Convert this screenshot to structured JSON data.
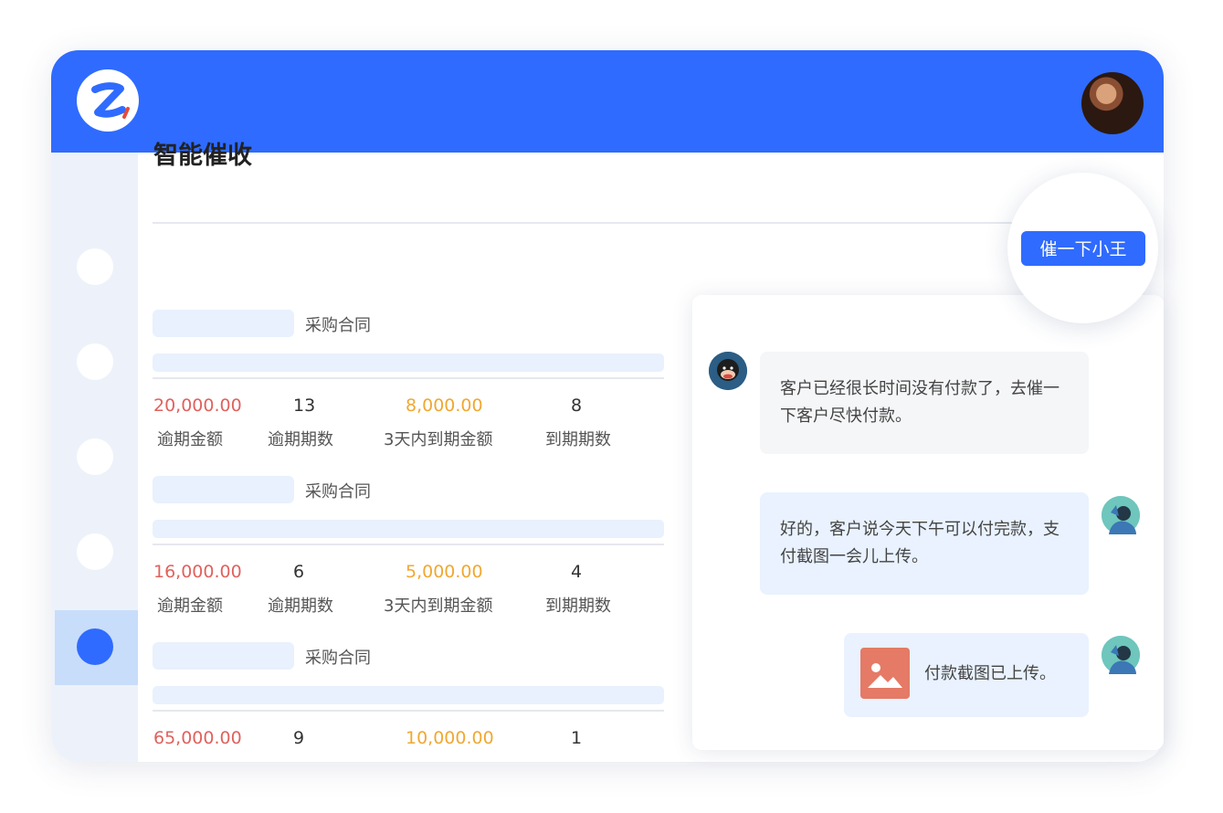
{
  "page": {
    "title": "智能催收"
  },
  "contracts": [
    {
      "name": "采购合同",
      "overdue_amount": "20,000.00",
      "overdue_periods": "13",
      "due_3days_amount": "8,000.00",
      "due_periods": "8"
    },
    {
      "name": "采购合同",
      "overdue_amount": "16,000.00",
      "overdue_periods": "6",
      "due_3days_amount": "5,000.00",
      "due_periods": "4"
    },
    {
      "name": "采购合同",
      "overdue_amount": "65,000.00",
      "overdue_periods": "9",
      "due_3days_amount": "10,000.00",
      "due_periods": "1"
    }
  ],
  "stat_labels": {
    "overdue_amount": "逾期金额",
    "overdue_periods": "逾期期数",
    "due_3days_amount": "3天内到期金额",
    "due_periods": "到期期数"
  },
  "action": {
    "remind_label": "催一下小王"
  },
  "chat": {
    "messages": [
      {
        "text": "客户已经很长时间没有付款了，去催一下客户尽快付款。"
      },
      {
        "text": "好的，客户说今天下午可以付完款，支付截图一会儿上传。"
      },
      {
        "text": "付款截图已上传。",
        "icon": "image-icon"
      }
    ]
  },
  "colors": {
    "primary": "#2f6bff",
    "overdue": "#e0625d",
    "due_soon": "#f0a832",
    "sidebar_bg": "#edf2fa",
    "sidebar_active": "#c8ddfa"
  },
  "icons": {
    "logo": "z-logo",
    "user_avatar": "avatar",
    "bot_avatar": "monkey-avatar",
    "attachment": "image-icon"
  }
}
